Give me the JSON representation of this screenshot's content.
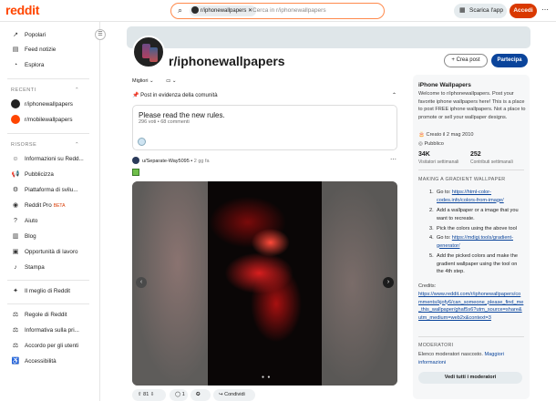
{
  "header": {
    "logo": "reddit",
    "search_chip": "r/iphonewallpapers",
    "search_placeholder": "Cerca in r/iphonewallpapers",
    "app_button": "Scarica l'app",
    "login_button": "Accedi"
  },
  "sidebar": {
    "top_items": [
      "Popolari",
      "Feed notizie",
      "Esplora"
    ],
    "recent_heading": "RECENTI",
    "recent_items": [
      "r/iphonewallpapers",
      "r/mobilewallpapers"
    ],
    "resources_heading": "RISORSE",
    "resource_items": [
      "Informazioni su Redd...",
      "Pubblicizza",
      "Piattaforma di svilu...",
      "Reddit Pro",
      "Aiuto",
      "Blog",
      "Opportunità di lavoro",
      "Stampa"
    ],
    "beta_badge": "BETA",
    "best_of": "Il meglio di Reddit",
    "policy_items": [
      "Regole di Reddit",
      "Informativa sulla pri...",
      "Accordo per gli utenti",
      "Accessibilità"
    ]
  },
  "community": {
    "name": "r/iphonewallpapers",
    "create_post": "Crea post",
    "join": "Partecipa",
    "sort_label": "Migliori"
  },
  "featured": {
    "heading": "Post in evidenza della comunità",
    "pinned_title": "Please read the new rules.",
    "pinned_meta": "296 voti • 68 commenti"
  },
  "post": {
    "author": "u/Separate-Way5095",
    "age": "2 gg fa",
    "votes": "81",
    "comments": "1",
    "share": "Condividi"
  },
  "right_panel": {
    "title": "iPhone Wallpapers",
    "description": "Welcome to r/iphonewallpapers. Post your favorite iphone wallpapers here! This is a place to post FREE iphone wallpapers. Not a place to promote or sell your wallpaper designs.",
    "created": "Creato il 2 mag 2010",
    "visibility": "Pubblico",
    "visitors_num": "34K",
    "visitors_lbl": "Visitatori settimanali",
    "contrib_num": "252",
    "contrib_lbl": "Contributi settimanali",
    "gradient_heading": "MAKING A GRADIENT WALLPAPER",
    "steps": [
      {
        "pre": "Go to: ",
        "link": "https://html-color-codes.info/colors-from-image/",
        "post": ""
      },
      {
        "pre": "Add a wallpaper or a image that you want to recreate.",
        "link": "",
        "post": ""
      },
      {
        "pre": "Pick the colors using the above tool",
        "link": "",
        "post": ""
      },
      {
        "pre": "Go to: ",
        "link": "https://mdigi.tools/gradient-generator/",
        "post": ""
      },
      {
        "pre": "Add the picked colors and make the gradient wallpaper using the tool on the 4th step.",
        "link": "",
        "post": ""
      }
    ],
    "credits_label": "Credits:",
    "credits_link": "https://www.reddit.com/r/iphonewallpapers/comments/kjofy6/can_someone_please_find_me_this_wallpaper/ghaf5s6?utm_source=share&utm_medium=web2x&context=3",
    "moderators_heading": "MODERATORI",
    "moderators_text": "Elenco moderatori nascosto.",
    "moderators_link": "Maggiori informazioni",
    "moderators_button": "Vedi tutti i moderatori"
  }
}
